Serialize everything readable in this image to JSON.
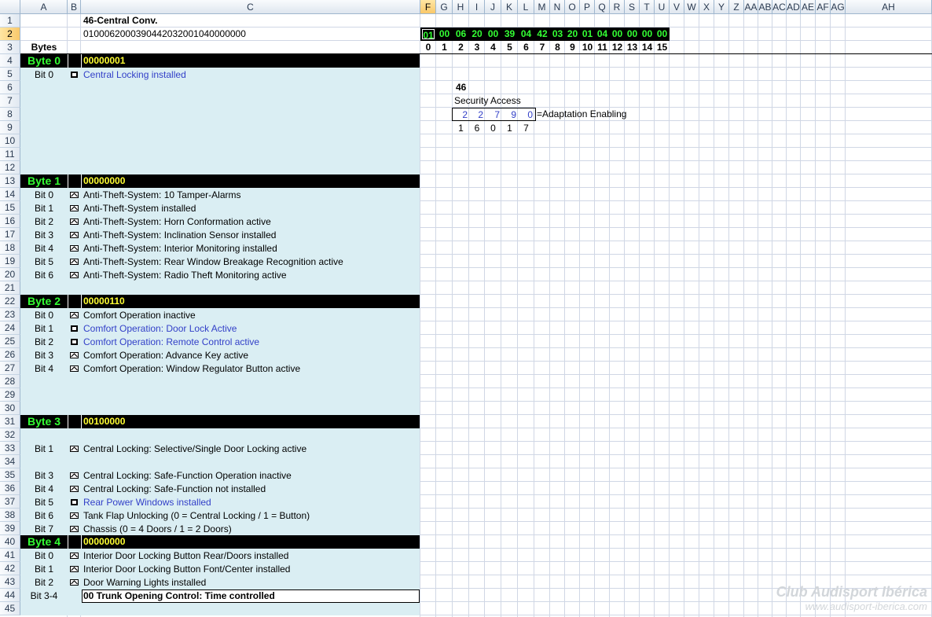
{
  "columns": [
    "A",
    "B",
    "C",
    "F",
    "G",
    "H",
    "I",
    "J",
    "K",
    "L",
    "M",
    "N",
    "O",
    "P",
    "Q",
    "R",
    "S",
    "T",
    "U",
    "V",
    "W",
    "X",
    "Y",
    "Z",
    "AA",
    "AB",
    "AC",
    "AD",
    "AE",
    "AF",
    "AG",
    "AH"
  ],
  "rows": [
    "1",
    "2",
    "3",
    "4",
    "5",
    "6",
    "7",
    "8",
    "9",
    "10",
    "11",
    "12",
    "13",
    "14",
    "15",
    "16",
    "17",
    "18",
    "19",
    "20",
    "21",
    "22",
    "23",
    "24",
    "25",
    "26",
    "27",
    "28",
    "29",
    "30",
    "31",
    "32",
    "33",
    "34",
    "35",
    "36",
    "37",
    "38",
    "39",
    "40",
    "41",
    "42",
    "43",
    "44",
    "45"
  ],
  "header": {
    "title": "46-Central Conv.",
    "coding": "0100062000390442032001040000000",
    "bytes_label": "Bytes"
  },
  "hex_bytes": [
    "01",
    "00",
    "06",
    "20",
    "00",
    "39",
    "04",
    "42",
    "03",
    "20",
    "01",
    "04",
    "00",
    "00",
    "00",
    "00"
  ],
  "hex_index": [
    "0",
    "1",
    "2",
    "3",
    "4",
    "5",
    "6",
    "7",
    "8",
    "9",
    "10",
    "11",
    "12",
    "13",
    "14",
    "15"
  ],
  "security": {
    "module": "46",
    "label": "Security Access",
    "code": [
      "2",
      "2",
      "7",
      "9",
      "0"
    ],
    "code_note": "=Adaptation Enabling",
    "login": [
      "1",
      "6",
      "0",
      "1",
      "7"
    ]
  },
  "bytes": [
    {
      "label": "Byte 0",
      "value": "00000001",
      "bits": [
        {
          "bit": "Bit 0",
          "desc": "Central Locking installed",
          "style": "blue",
          "check": "off"
        }
      ]
    },
    {
      "label": "Byte 1",
      "value": "00000000",
      "bits": [
        {
          "bit": "Bit 0",
          "desc": "Anti-Theft-System: 10 Tamper-Alarms",
          "style": "black",
          "check": "tick"
        },
        {
          "bit": "Bit 1",
          "desc": "Anti-Theft-System installed",
          "style": "black",
          "check": "tick"
        },
        {
          "bit": "Bit 2",
          "desc": "Anti-Theft-System: Horn Conformation active",
          "style": "black",
          "check": "tick"
        },
        {
          "bit": "Bit 3",
          "desc": "Anti-Theft-System: Inclination Sensor installed",
          "style": "black",
          "check": "tick"
        },
        {
          "bit": "Bit 4",
          "desc": "Anti-Theft-System: Interior Monitoring installed",
          "style": "black",
          "check": "tick"
        },
        {
          "bit": "Bit 5",
          "desc": "Anti-Theft-System: Rear Window Breakage Recognition active",
          "style": "black",
          "check": "tick"
        },
        {
          "bit": "Bit 6",
          "desc": "Anti-Theft-System: Radio Theft Monitoring active",
          "style": "black",
          "check": "tick"
        }
      ]
    },
    {
      "label": "Byte 2",
      "value": "00000110",
      "bits": [
        {
          "bit": "Bit 0",
          "desc": "Comfort Operation inactive",
          "style": "black",
          "check": "tick"
        },
        {
          "bit": "Bit 1",
          "desc": "Comfort Operation: Door Lock Active",
          "style": "blue",
          "check": "off"
        },
        {
          "bit": "Bit 2",
          "desc": "Comfort Operation: Remote Control active",
          "style": "blue",
          "check": "off"
        },
        {
          "bit": "Bit 3",
          "desc": "Comfort Operation: Advance Key active",
          "style": "black",
          "check": "tick"
        },
        {
          "bit": "Bit 4",
          "desc": "Comfort Operation: Window Regulator Button active",
          "style": "black",
          "check": "tick"
        }
      ]
    },
    {
      "label": "Byte 3",
      "value": "00100000",
      "bits": [
        {
          "bit": "Bit 1",
          "desc": "Central Locking: Selective/Single Door Locking active",
          "style": "black",
          "check": "tick"
        },
        {
          "bit": "Bit 3",
          "desc": "Central Locking: Safe-Function Operation inactive",
          "style": "black",
          "check": "tick"
        },
        {
          "bit": "Bit 4",
          "desc": "Central Locking: Safe-Function not installed",
          "style": "black",
          "check": "tick"
        },
        {
          "bit": "Bit 5",
          "desc": "Rear Power Windows installed",
          "style": "blue",
          "check": "off"
        },
        {
          "bit": "Bit 6",
          "desc": "Tank Flap Unlocking (0 = Central Locking / 1 = Button)",
          "style": "black",
          "check": "tick"
        },
        {
          "bit": "Bit 7",
          "desc": "Chassis (0 = 4 Doors / 1 = 2 Doors)",
          "style": "black",
          "check": "tick"
        }
      ]
    },
    {
      "label": "Byte 4",
      "value": "00000000",
      "bits": [
        {
          "bit": "Bit 0",
          "desc": "Interior Door Locking Button Rear/Doors installed",
          "style": "black",
          "check": "tick"
        },
        {
          "bit": "Bit 1",
          "desc": "Interior Door Locking Button Font/Center installed",
          "style": "black",
          "check": "tick"
        },
        {
          "bit": "Bit 2",
          "desc": "Door Warning Lights installed",
          "style": "black",
          "check": "tick"
        }
      ]
    }
  ],
  "trunk": {
    "bit": "Bit 3-4",
    "value": "00 Trunk Opening Control: Time controlled"
  },
  "watermark": {
    "line1": "Club Audisport Ibérica",
    "line2": "www.audisport-iberica.com"
  }
}
